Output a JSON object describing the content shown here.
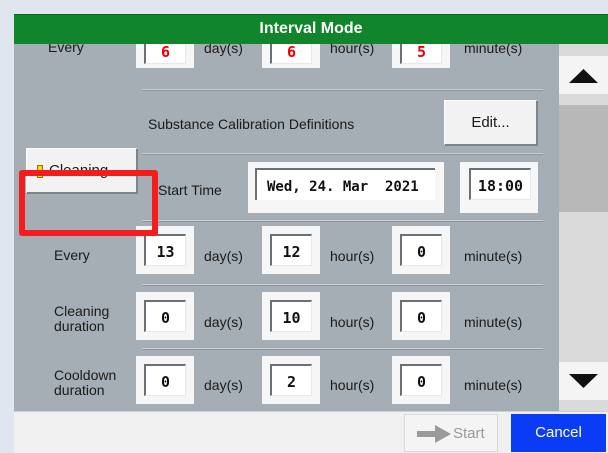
{
  "dialog": {
    "title": "Interval Mode"
  },
  "top_partial_row": {
    "label": "Every",
    "days": "6",
    "hours": "6",
    "minutes": "5",
    "day_unit": "day(s)",
    "hour_unit": "hour(s)",
    "minute_unit": "minute(s)"
  },
  "calibration": {
    "label": "Substance Calibration Definitions",
    "edit_button": "Edit..."
  },
  "cleaning": {
    "button_label": "Cleaning",
    "start_time_label": "Start Time",
    "start_date": "Wed, 24. Mar  2021",
    "start_time": "18:00",
    "every_label": "Every",
    "every_days": "13",
    "every_hours": "12",
    "every_minutes": "0",
    "duration_label_line1": "Cleaning",
    "duration_label_line2": "duration",
    "duration_days": "0",
    "duration_hours": "10",
    "duration_minutes": "0",
    "cooldown_label_line1": "Cooldown",
    "cooldown_label_line2": "duration",
    "cooldown_days": "0",
    "cooldown_hours": "2",
    "cooldown_minutes": "0",
    "day_unit": "day(s)",
    "hour_unit": "hour(s)",
    "minute_unit": "minute(s)"
  },
  "footer": {
    "start_label": "Start",
    "cancel_label": "Cancel"
  },
  "colors": {
    "titlebar": "#10852c",
    "highlight": "#f41c1c",
    "cancel": "#0a3cf5",
    "indicator": "#ffd400"
  },
  "icons": {
    "scroll_up": "triangle-up-icon",
    "scroll_down": "triangle-down-icon",
    "start": "arrow-right-icon",
    "cleaning_indicator": "status-indicator-icon"
  }
}
